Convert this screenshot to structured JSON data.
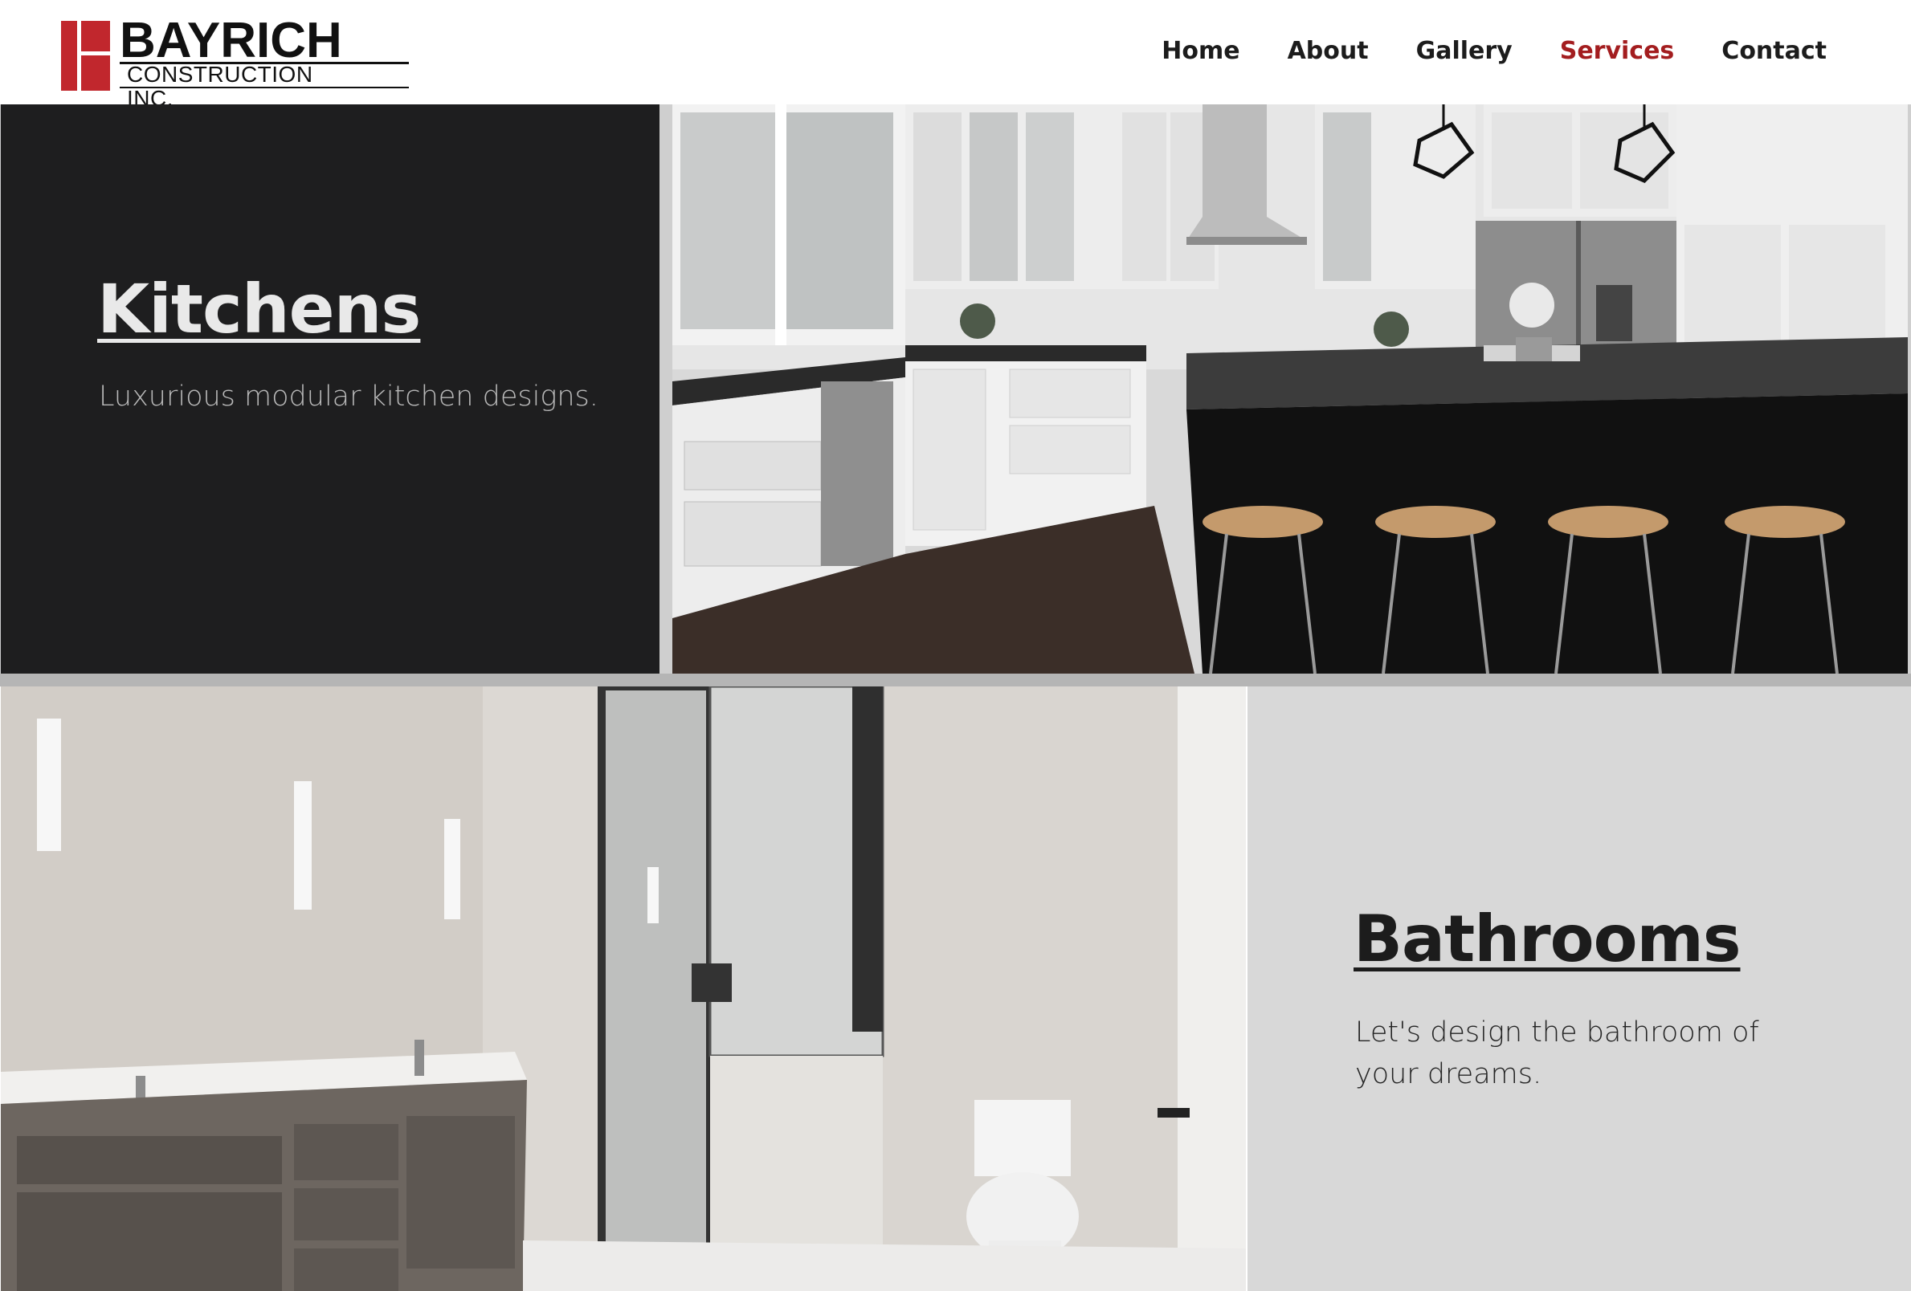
{
  "brand": {
    "name": "BAYRICH",
    "subtitle": "CONSTRUCTION INC.",
    "colors": {
      "red": "#c1272d",
      "dark": "#111111"
    }
  },
  "nav": {
    "items": [
      {
        "label": "Home",
        "active": false
      },
      {
        "label": "About",
        "active": false
      },
      {
        "label": "Gallery",
        "active": false
      },
      {
        "label": "Services",
        "active": true
      },
      {
        "label": "Contact",
        "active": false
      }
    ],
    "active_color": "#a31d1f"
  },
  "services": {
    "kitchens": {
      "title": "Kitchens",
      "description": "Luxurious modular kitchen designs.",
      "panel_color": "#1e1e1f"
    },
    "bathrooms": {
      "title": "Bathrooms",
      "description": "Let's design the bathroom of your dreams.",
      "panel_color": "#d8d8d8"
    }
  }
}
